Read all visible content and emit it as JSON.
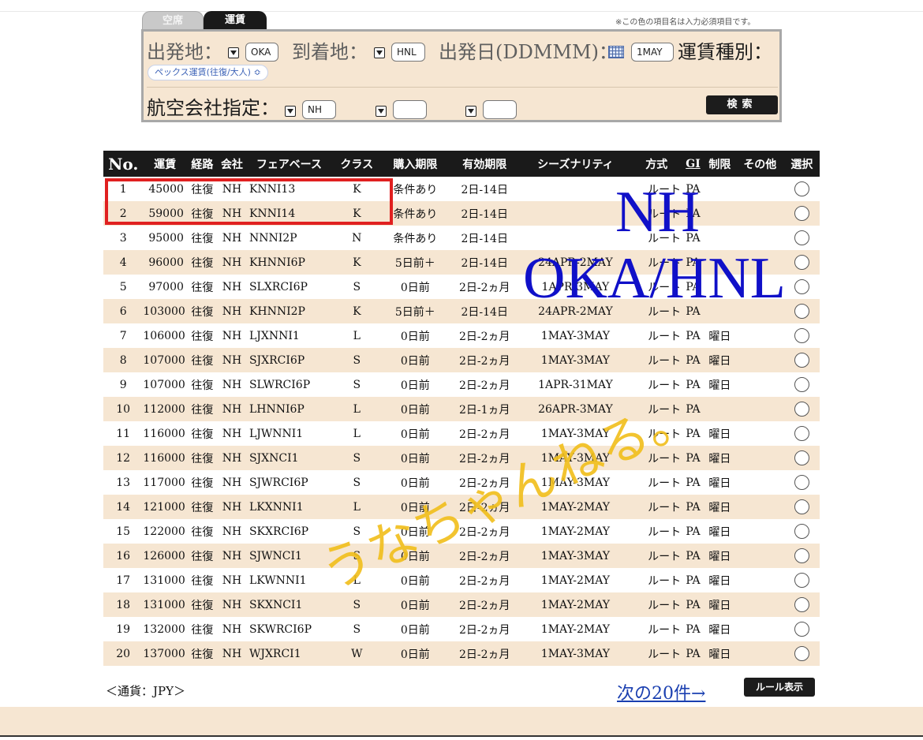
{
  "tabs": [
    {
      "label": "空席"
    },
    {
      "label": "運賃"
    }
  ],
  "required_note": "※この色の項目名は入力必須項目です。",
  "search": {
    "departure_label": "出発地：",
    "departure_value": "OKA",
    "arrival_label": "到着地：",
    "arrival_value": "HNL",
    "date_label": "出発日(DDMMM)：",
    "date_value": "1MAY",
    "fare_type_label": "運賃種別：",
    "fare_type_value": "ペックス運賃(往復/大人) ≎",
    "airline_label": "航空会社指定：",
    "airline_values": [
      "NH",
      "",
      ""
    ],
    "search_button": "検索"
  },
  "table": {
    "headers": [
      "No.",
      "運賃",
      "経路",
      "会社",
      "フェアベース",
      "クラス",
      "購入期限",
      "有効期限",
      "シーズナリティ",
      "方式",
      "GI",
      "制限",
      "その他",
      "選択"
    ],
    "rows": [
      {
        "no": "1",
        "fare": "45000",
        "route": "往復",
        "carrier": "NH",
        "fare_basis": "KNNI13",
        "class": "K",
        "purchase": "条件あり",
        "validity": "2日-14日",
        "season": "",
        "method": "ルート",
        "gi": "PA",
        "restriction": ""
      },
      {
        "no": "2",
        "fare": "59000",
        "route": "往復",
        "carrier": "NH",
        "fare_basis": "KNNI14",
        "class": "K",
        "purchase": "条件あり",
        "validity": "2日-14日",
        "season": "",
        "method": "ルート",
        "gi": "PA",
        "restriction": ""
      },
      {
        "no": "3",
        "fare": "95000",
        "route": "往復",
        "carrier": "NH",
        "fare_basis": "NNNI2P",
        "class": "N",
        "purchase": "条件あり",
        "validity": "2日-14日",
        "season": "",
        "method": "ルート",
        "gi": "PA",
        "restriction": ""
      },
      {
        "no": "4",
        "fare": "96000",
        "route": "往復",
        "carrier": "NH",
        "fare_basis": "KHNNI6P",
        "class": "K",
        "purchase": "5日前＋",
        "validity": "2日-14日",
        "season": "24APR-2MAY",
        "method": "ルート",
        "gi": "PA",
        "restriction": ""
      },
      {
        "no": "5",
        "fare": "97000",
        "route": "往復",
        "carrier": "NH",
        "fare_basis": "SLXRCI6P",
        "class": "S",
        "purchase": "0日前",
        "validity": "2日-2ヵ月",
        "season": "1APR-3MAY",
        "method": "ルート",
        "gi": "PA",
        "restriction": ""
      },
      {
        "no": "6",
        "fare": "103000",
        "route": "往復",
        "carrier": "NH",
        "fare_basis": "KHNNI2P",
        "class": "K",
        "purchase": "5日前＋",
        "validity": "2日-14日",
        "season": "24APR-2MAY",
        "method": "ルート",
        "gi": "PA",
        "restriction": ""
      },
      {
        "no": "7",
        "fare": "106000",
        "route": "往復",
        "carrier": "NH",
        "fare_basis": "LJXNNI1",
        "class": "L",
        "purchase": "0日前",
        "validity": "2日-2ヵ月",
        "season": "1MAY-3MAY",
        "method": "ルート",
        "gi": "PA",
        "restriction": "曜日"
      },
      {
        "no": "8",
        "fare": "107000",
        "route": "往復",
        "carrier": "NH",
        "fare_basis": "SJXRCI6P",
        "class": "S",
        "purchase": "0日前",
        "validity": "2日-2ヵ月",
        "season": "1MAY-3MAY",
        "method": "ルート",
        "gi": "PA",
        "restriction": "曜日"
      },
      {
        "no": "9",
        "fare": "107000",
        "route": "往復",
        "carrier": "NH",
        "fare_basis": "SLWRCI6P",
        "class": "S",
        "purchase": "0日前",
        "validity": "2日-2ヵ月",
        "season": "1APR-31MAY",
        "method": "ルート",
        "gi": "PA",
        "restriction": "曜日"
      },
      {
        "no": "10",
        "fare": "112000",
        "route": "往復",
        "carrier": "NH",
        "fare_basis": "LHNNI6P",
        "class": "L",
        "purchase": "0日前",
        "validity": "2日-1ヵ月",
        "season": "26APR-3MAY",
        "method": "ルート",
        "gi": "PA",
        "restriction": ""
      },
      {
        "no": "11",
        "fare": "116000",
        "route": "往復",
        "carrier": "NH",
        "fare_basis": "LJWNNI1",
        "class": "L",
        "purchase": "0日前",
        "validity": "2日-2ヵ月",
        "season": "1MAY-3MAY",
        "method": "ルート",
        "gi": "PA",
        "restriction": "曜日"
      },
      {
        "no": "12",
        "fare": "116000",
        "route": "往復",
        "carrier": "NH",
        "fare_basis": "SJXNCI1",
        "class": "S",
        "purchase": "0日前",
        "validity": "2日-2ヵ月",
        "season": "1MAY-3MAY",
        "method": "ルート",
        "gi": "PA",
        "restriction": "曜日"
      },
      {
        "no": "13",
        "fare": "117000",
        "route": "往復",
        "carrier": "NH",
        "fare_basis": "SJWRCI6P",
        "class": "S",
        "purchase": "0日前",
        "validity": "2日-2ヵ月",
        "season": "1MAY-3MAY",
        "method": "ルート",
        "gi": "PA",
        "restriction": "曜日"
      },
      {
        "no": "14",
        "fare": "121000",
        "route": "往復",
        "carrier": "NH",
        "fare_basis": "LKXNNI1",
        "class": "L",
        "purchase": "0日前",
        "validity": "2日-2ヵ月",
        "season": "1MAY-2MAY",
        "method": "ルート",
        "gi": "PA",
        "restriction": "曜日"
      },
      {
        "no": "15",
        "fare": "122000",
        "route": "往復",
        "carrier": "NH",
        "fare_basis": "SKXRCI6P",
        "class": "S",
        "purchase": "0日前",
        "validity": "2日-2ヵ月",
        "season": "1MAY-2MAY",
        "method": "ルート",
        "gi": "PA",
        "restriction": "曜日"
      },
      {
        "no": "16",
        "fare": "126000",
        "route": "往復",
        "carrier": "NH",
        "fare_basis": "SJWNCI1",
        "class": "S",
        "purchase": "0日前",
        "validity": "2日-2ヵ月",
        "season": "1MAY-3MAY",
        "method": "ルート",
        "gi": "PA",
        "restriction": "曜日"
      },
      {
        "no": "17",
        "fare": "131000",
        "route": "往復",
        "carrier": "NH",
        "fare_basis": "LKWNNI1",
        "class": "L",
        "purchase": "0日前",
        "validity": "2日-2ヵ月",
        "season": "1MAY-2MAY",
        "method": "ルート",
        "gi": "PA",
        "restriction": "曜日"
      },
      {
        "no": "18",
        "fare": "131000",
        "route": "往復",
        "carrier": "NH",
        "fare_basis": "SKXNCI1",
        "class": "S",
        "purchase": "0日前",
        "validity": "2日-2ヵ月",
        "season": "1MAY-2MAY",
        "method": "ルート",
        "gi": "PA",
        "restriction": "曜日"
      },
      {
        "no": "19",
        "fare": "132000",
        "route": "往復",
        "carrier": "NH",
        "fare_basis": "SKWRCI6P",
        "class": "S",
        "purchase": "0日前",
        "validity": "2日-2ヵ月",
        "season": "1MAY-2MAY",
        "method": "ルート",
        "gi": "PA",
        "restriction": "曜日"
      },
      {
        "no": "20",
        "fare": "137000",
        "route": "往復",
        "carrier": "NH",
        "fare_basis": "WJXRCI1",
        "class": "W",
        "purchase": "0日前",
        "validity": "2日-2ヵ月",
        "season": "1MAY-3MAY",
        "method": "ルート",
        "gi": "PA",
        "restriction": "曜日"
      }
    ]
  },
  "overlay": {
    "carrier": "NH",
    "route": "OKA/HNL",
    "signature": "うなちゃんねる。"
  },
  "footer": {
    "currency": "＜通貨：JPY＞",
    "next_link": "次の20件→",
    "rule_button": "ルール表示"
  }
}
